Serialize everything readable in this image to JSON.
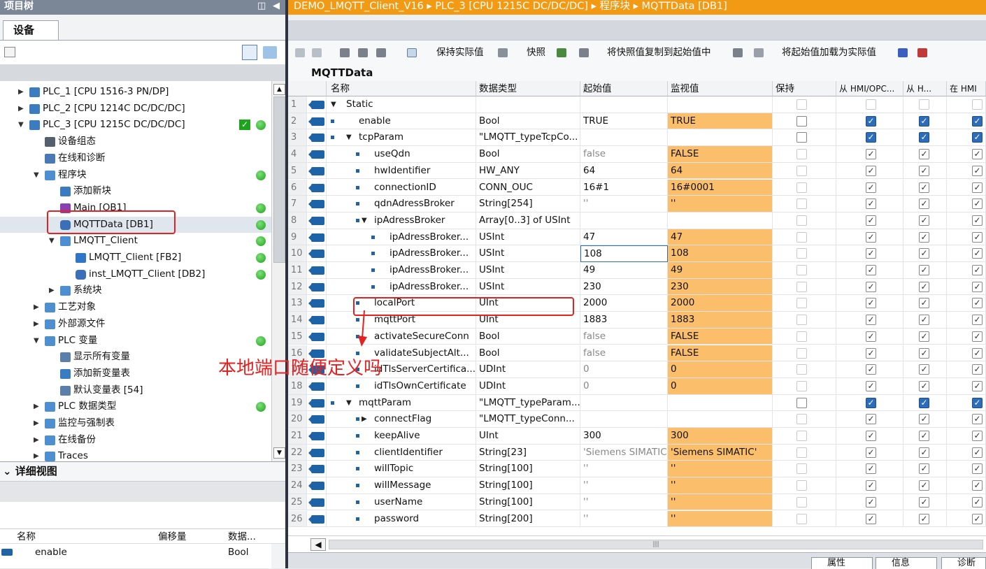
{
  "left_panel": {
    "title": "项目树",
    "devices_tab": "设备",
    "tree": [
      {
        "label": "PLC_1 [CPU 1516-3 PN/DP]",
        "level": 0,
        "arrow": "▶",
        "icon": "plc-icon"
      },
      {
        "label": "PLC_2 [CPU 1214C DC/DC/DC]",
        "level": 0,
        "arrow": "▶",
        "icon": "plc-icon"
      },
      {
        "label": "PLC_3 [CPU 1215C DC/DC/DC]",
        "level": 0,
        "arrow": "▼",
        "icon": "plc-icon",
        "status": "ok-check-and-dot"
      },
      {
        "label": "设备组态",
        "level": 1,
        "arrow": "",
        "icon": "device-config-icon"
      },
      {
        "label": "在线和诊断",
        "level": 1,
        "arrow": "",
        "icon": "diagnostics-icon"
      },
      {
        "label": "程序块",
        "level": 1,
        "arrow": "▼",
        "icon": "folder-icon",
        "status": "dot"
      },
      {
        "label": "添加新块",
        "level": 2,
        "arrow": "",
        "icon": "add-block-icon"
      },
      {
        "label": "Main [OB1]",
        "level": 2,
        "arrow": "",
        "icon": "ob-icon",
        "status": "dot"
      },
      {
        "label": "MQTTData [DB1]",
        "level": 2,
        "arrow": "",
        "icon": "db-icon",
        "status": "dot",
        "selected": true
      },
      {
        "label": "LMQTT_Client",
        "level": 2,
        "arrow": "▼",
        "icon": "folder-icon",
        "status": "dot"
      },
      {
        "label": "LMQTT_Client [FB2]",
        "level": 3,
        "arrow": "",
        "icon": "fb-icon",
        "status": "dot"
      },
      {
        "label": "inst_LMQTT_Client [DB2]",
        "level": 3,
        "arrow": "",
        "icon": "db-icon",
        "status": "dot"
      },
      {
        "label": "系统块",
        "level": 2,
        "arrow": "▶",
        "icon": "folder-icon"
      },
      {
        "label": "工艺对象",
        "level": 1,
        "arrow": "▶",
        "icon": "folder-icon"
      },
      {
        "label": "外部源文件",
        "level": 1,
        "arrow": "▶",
        "icon": "folder-icon"
      },
      {
        "label": "PLC 变量",
        "level": 1,
        "arrow": "▼",
        "icon": "folder-icon",
        "status": "dot"
      },
      {
        "label": "显示所有变量",
        "level": 2,
        "arrow": "",
        "icon": "tags-icon"
      },
      {
        "label": "添加新变量表",
        "level": 2,
        "arrow": "",
        "icon": "add-table-icon"
      },
      {
        "label": "默认变量表 [54]",
        "level": 2,
        "arrow": "",
        "icon": "tag-table-icon"
      },
      {
        "label": "PLC 数据类型",
        "level": 1,
        "arrow": "▶",
        "icon": "folder-icon",
        "status": "dot"
      },
      {
        "label": "监控与强制表",
        "level": 1,
        "arrow": "▶",
        "icon": "folder-icon"
      },
      {
        "label": "在线备份",
        "level": 1,
        "arrow": "▶",
        "icon": "folder-icon"
      },
      {
        "label": "Traces",
        "level": 1,
        "arrow": "▶",
        "icon": "folder-icon"
      }
    ],
    "detail_view": {
      "title": "详细视图",
      "columns": [
        "名称",
        "偏移量",
        "数据..."
      ],
      "row": {
        "name": "enable",
        "type": "Bool"
      }
    }
  },
  "breadcrumb": [
    "DEMO_LMQTT_Client_V16",
    "PLC_3 [CPU 1215C DC/DC/DC]",
    "程序块",
    "MQTTData [DB1]"
  ],
  "toolbar": {
    "keep_actual": "保持实际值",
    "snapshot": "快照",
    "copy_snapshot": "将快照值复制到起始值中",
    "load_start": "将起始值加载为实际值"
  },
  "db_title": "MQTTData",
  "grid": {
    "headers": [
      "名称",
      "数据类型",
      "起始值",
      "监视值",
      "保持",
      "从 HMI/OPC...",
      "从 H...",
      "在 HMI"
    ],
    "rows": [
      {
        "n": "1",
        "lvl": 0,
        "tri": "▼",
        "bullet": false,
        "name": "Static",
        "type": "",
        "start": "",
        "mon": "",
        "cbs": "none"
      },
      {
        "n": "2",
        "lvl": 1,
        "tri": "",
        "bullet": true,
        "name": "enable",
        "type": "Bool",
        "start": "TRUE",
        "mon": "TRUE",
        "cbs": "top"
      },
      {
        "n": "3",
        "lvl": 1,
        "tri": "▼",
        "bullet": true,
        "name": "tcpParam",
        "type": "\"LMQTT_typeTcpCo...",
        "start": "",
        "mon": "",
        "cbs": "top"
      },
      {
        "n": "4",
        "lvl": 2,
        "tri": "",
        "bullet": true,
        "name": "useQdn",
        "type": "Bool",
        "start": "false",
        "mon": "FALSE",
        "cbs": "sub",
        "gray": true
      },
      {
        "n": "5",
        "lvl": 2,
        "tri": "",
        "bullet": true,
        "name": "hwIdentifier",
        "type": "HW_ANY",
        "start": "64",
        "mon": "64",
        "cbs": "sub"
      },
      {
        "n": "6",
        "lvl": 2,
        "tri": "",
        "bullet": true,
        "name": "connectionID",
        "type": "CONN_OUC",
        "start": "16#1",
        "mon": "16#0001",
        "cbs": "sub"
      },
      {
        "n": "7",
        "lvl": 2,
        "tri": "",
        "bullet": true,
        "name": "qdnAdressBroker",
        "type": "String[254]",
        "start": "''",
        "mon": "''",
        "cbs": "sub",
        "gray": true
      },
      {
        "n": "8",
        "lvl": 2,
        "tri": "▼",
        "bullet": true,
        "name": "ipAdressBroker",
        "type": "Array[0..3] of USInt",
        "start": "",
        "mon": "",
        "cbs": "sub"
      },
      {
        "n": "9",
        "lvl": 3,
        "tri": "",
        "bullet": true,
        "name": "ipAdressBroker...",
        "type": "USInt",
        "start": "47",
        "mon": "47",
        "cbs": "sub"
      },
      {
        "n": "10",
        "lvl": 3,
        "tri": "",
        "bullet": true,
        "name": "ipAdressBroker...",
        "type": "USInt",
        "start": "108",
        "mon": "108",
        "cbs": "sub",
        "edit": true
      },
      {
        "n": "11",
        "lvl": 3,
        "tri": "",
        "bullet": true,
        "name": "ipAdressBroker...",
        "type": "USInt",
        "start": "49",
        "mon": "49",
        "cbs": "sub"
      },
      {
        "n": "12",
        "lvl": 3,
        "tri": "",
        "bullet": true,
        "name": "ipAdressBroker...",
        "type": "USInt",
        "start": "230",
        "mon": "230",
        "cbs": "sub"
      },
      {
        "n": "13",
        "lvl": 2,
        "tri": "",
        "bullet": true,
        "name": "localPort",
        "type": "UInt",
        "start": "2000",
        "mon": "2000",
        "cbs": "sub"
      },
      {
        "n": "14",
        "lvl": 2,
        "tri": "",
        "bullet": true,
        "name": "mqttPort",
        "type": "UInt",
        "start": "1883",
        "mon": "1883",
        "cbs": "sub"
      },
      {
        "n": "15",
        "lvl": 2,
        "tri": "",
        "bullet": true,
        "name": "activateSecureConn",
        "type": "Bool",
        "start": "false",
        "mon": "FALSE",
        "cbs": "sub",
        "gray": true
      },
      {
        "n": "16",
        "lvl": 2,
        "tri": "",
        "bullet": true,
        "name": "validateSubjectAlt...",
        "type": "Bool",
        "start": "false",
        "mon": "FALSE",
        "cbs": "sub",
        "gray": true
      },
      {
        "n": "17",
        "lvl": 2,
        "tri": "",
        "bullet": true,
        "name": "idTlsServerCertifica...",
        "type": "UDInt",
        "start": "0",
        "mon": "0",
        "cbs": "sub",
        "gray": true
      },
      {
        "n": "18",
        "lvl": 2,
        "tri": "",
        "bullet": true,
        "name": "idTlsOwnCertificate",
        "type": "UDInt",
        "start": "0",
        "mon": "0",
        "cbs": "sub",
        "gray": true
      },
      {
        "n": "19",
        "lvl": 1,
        "tri": "▼",
        "bullet": true,
        "name": "mqttParam",
        "type": "\"LMQTT_typeParam...",
        "start": "",
        "mon": "",
        "cbs": "top"
      },
      {
        "n": "20",
        "lvl": 2,
        "tri": "▶",
        "bullet": true,
        "name": "connectFlag",
        "type": "\"LMQTT_typeConn...",
        "start": "",
        "mon": "",
        "cbs": "sub"
      },
      {
        "n": "21",
        "lvl": 2,
        "tri": "",
        "bullet": true,
        "name": "keepAlive",
        "type": "UInt",
        "start": "300",
        "mon": "300",
        "cbs": "sub"
      },
      {
        "n": "22",
        "lvl": 2,
        "tri": "",
        "bullet": true,
        "name": "clientIdentifier",
        "type": "String[23]",
        "start": "'Siemens SIMATIC",
        "mon": "'Siemens SIMATIC'",
        "cbs": "sub",
        "gray": true
      },
      {
        "n": "23",
        "lvl": 2,
        "tri": "",
        "bullet": true,
        "name": "willTopic",
        "type": "String[100]",
        "start": "''",
        "mon": "''",
        "cbs": "sub",
        "gray": true
      },
      {
        "n": "24",
        "lvl": 2,
        "tri": "",
        "bullet": true,
        "name": "willMessage",
        "type": "String[100]",
        "start": "''",
        "mon": "''",
        "cbs": "sub",
        "gray": true
      },
      {
        "n": "25",
        "lvl": 2,
        "tri": "",
        "bullet": true,
        "name": "userName",
        "type": "String[100]",
        "start": "''",
        "mon": "''",
        "cbs": "sub",
        "gray": true
      },
      {
        "n": "26",
        "lvl": 2,
        "tri": "",
        "bullet": true,
        "name": "password",
        "type": "String[200]",
        "start": "''",
        "mon": "''",
        "cbs": "sub",
        "gray": true
      }
    ]
  },
  "status_tabs": [
    "属性",
    "信息",
    "诊断"
  ],
  "annotation": {
    "text": "本地端口随便定义吗",
    "color": "#e52222"
  },
  "colors": {
    "breadcrumb": "#f39a14",
    "monitor_highlight": "#fbbf6b",
    "title_bar": "#7b8696",
    "ok_green": "#1ea31c"
  }
}
